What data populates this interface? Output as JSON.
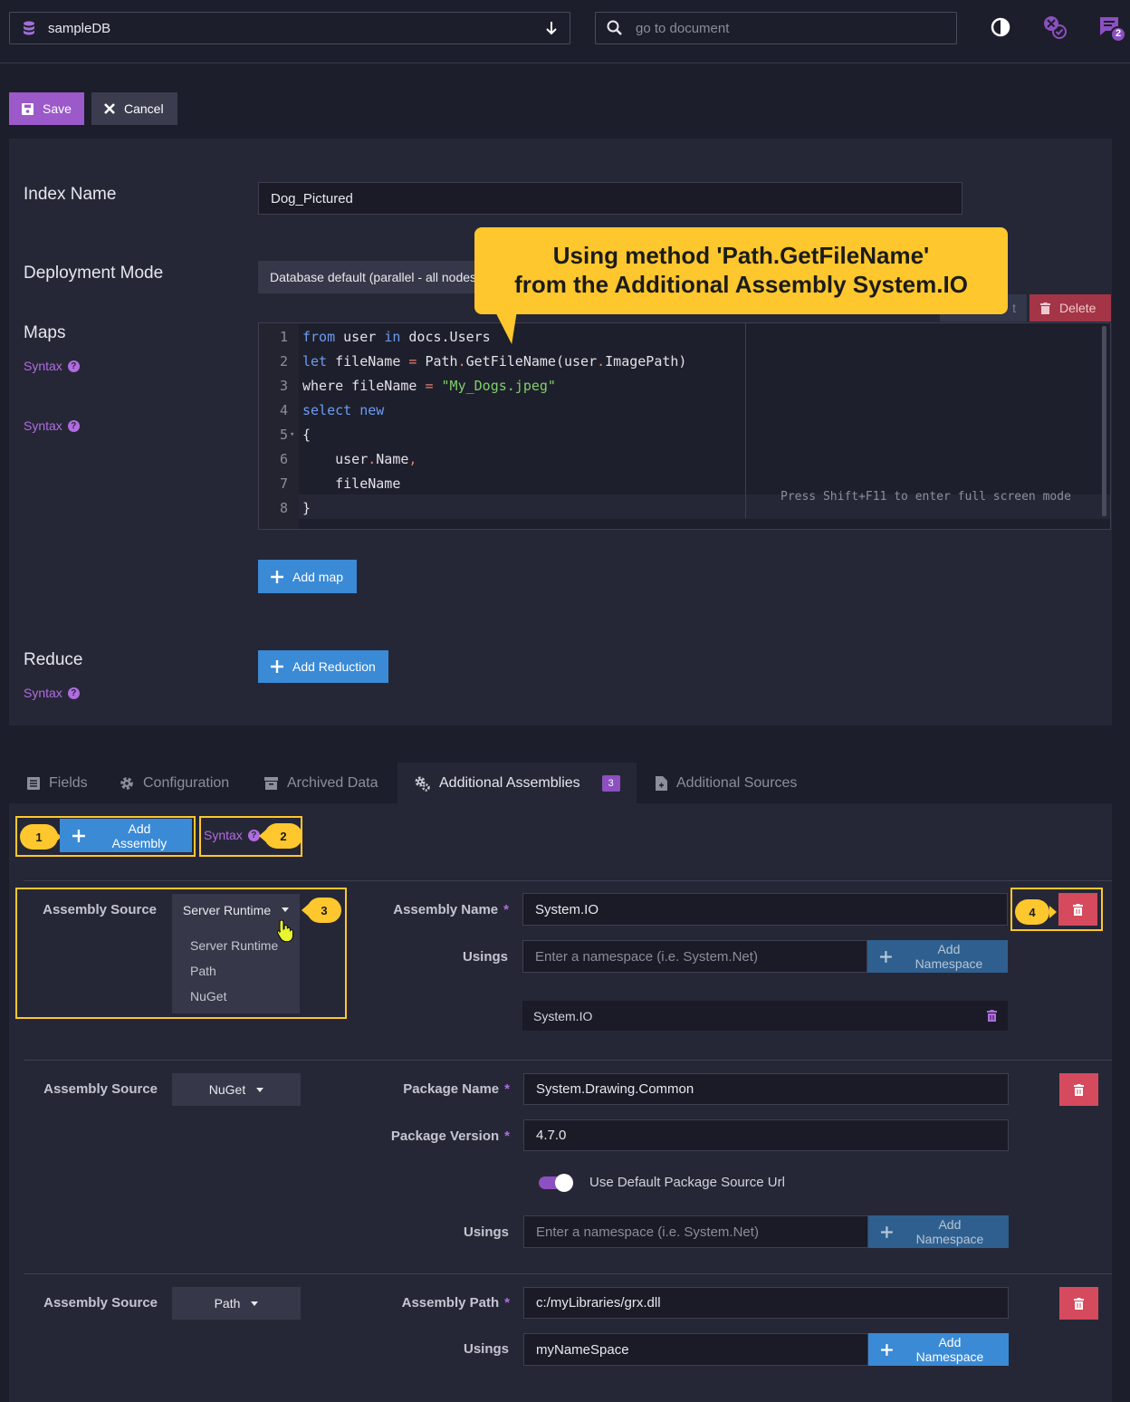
{
  "topbar": {
    "database": "sampleDB",
    "search_placeholder": "go to document",
    "notification_count": "2"
  },
  "toolbar": {
    "save_label": "Save",
    "cancel_label": "Cancel"
  },
  "form": {
    "index_name_label": "Index Name",
    "index_name_value": "Dog_Pictured",
    "deployment_mode_label": "Deployment Mode",
    "deployment_mode_value": "Database default (parallel - all nodes",
    "maps_label": "Maps",
    "syntax_label": "Syntax",
    "delete_map_label": "Delete",
    "add_map_label": "Add map",
    "reduce_label": "Reduce",
    "add_reduction_label": "Add Reduction",
    "fullscreen_hint": "Press Shift+F11 to enter full screen mode"
  },
  "callout": {
    "line1": "Using method 'Path.GetFileName'",
    "line2": "from the Additional Assembly System.IO"
  },
  "code": {
    "lines": [
      "1",
      "2",
      "3",
      "4",
      "5",
      "6",
      "7",
      "8"
    ]
  },
  "tabs": [
    {
      "label": "Fields",
      "icon": "list-icon"
    },
    {
      "label": "Configuration",
      "icon": "gear-icon"
    },
    {
      "label": "Archived Data",
      "icon": "archive-icon"
    },
    {
      "label": "Additional Assemblies",
      "icon": "gears-icon",
      "badge": "3"
    },
    {
      "label": "Additional Sources",
      "icon": "file-icon"
    }
  ],
  "assemblies": {
    "add_assembly_label": "Add Assembly",
    "syntax_label": "Syntax",
    "markers": [
      "1",
      "2",
      "3",
      "4"
    ],
    "source_label": "Assembly Source",
    "assembly_name_label": "Assembly Name",
    "usings_label": "Usings",
    "package_name_label": "Package Name",
    "package_version_label": "Package Version",
    "assembly_path_label": "Assembly Path",
    "namespace_placeholder": "Enter a namespace (i.e. System.Net)",
    "add_namespace_label": "Add Namespace",
    "use_default_source_label": "Use Default Package Source Url",
    "source_options": [
      "Server Runtime",
      "Path",
      "NuGet"
    ],
    "items": [
      {
        "source": "Server Runtime",
        "assembly_name": "System.IO",
        "using_chip": "System.IO"
      },
      {
        "source": "NuGet",
        "package_name": "System.Drawing.Common",
        "package_version": "4.7.0"
      },
      {
        "source": "Path",
        "assembly_path": "c:/myLibraries/grx.dll",
        "using_value": "myNameSpace"
      }
    ]
  },
  "colors": {
    "accent": "#9b59c9",
    "primary": "#3a8ad6",
    "danger": "#d64a5e",
    "callout": "#fdc72d"
  }
}
